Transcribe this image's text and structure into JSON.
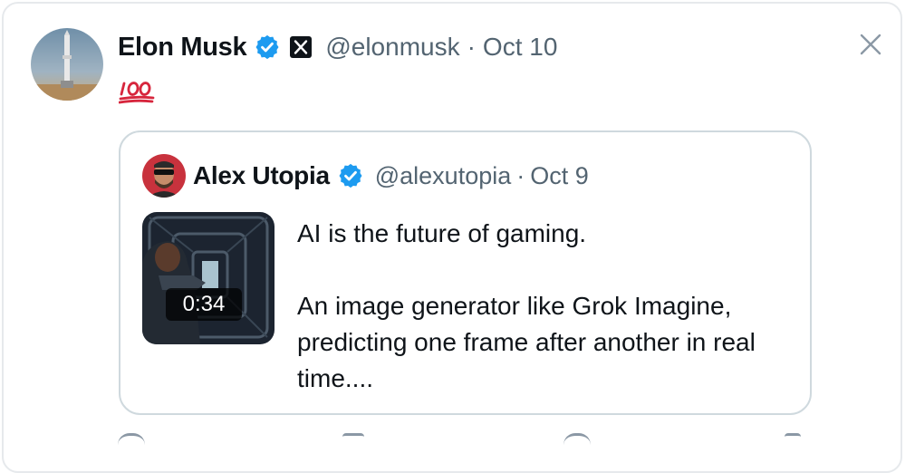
{
  "tweet": {
    "author_name": "Elon Musk",
    "handle": "@elonmusk",
    "separator": "·",
    "date": "Oct 10",
    "emoji": "💯",
    "icons": {
      "avatar": "rocket-photo-avatar",
      "verified": "verified-badge-icon",
      "affiliate": "x-logo-icon",
      "close": "close-icon"
    }
  },
  "quoted": {
    "author_name": "Alex Utopia",
    "handle": "@alexutopia",
    "separator": "·",
    "date": "Oct 9",
    "video_duration": "0:34",
    "text_line1": "AI is the future of gaming.",
    "text_line2": "An image generator like Grok Imagine, predicting one frame after another in real time...."
  },
  "colors": {
    "verified_blue": "#1d9bf0",
    "secondary_text": "#536471",
    "border": "#cfd9de",
    "emoji_red": "#d7263d"
  }
}
